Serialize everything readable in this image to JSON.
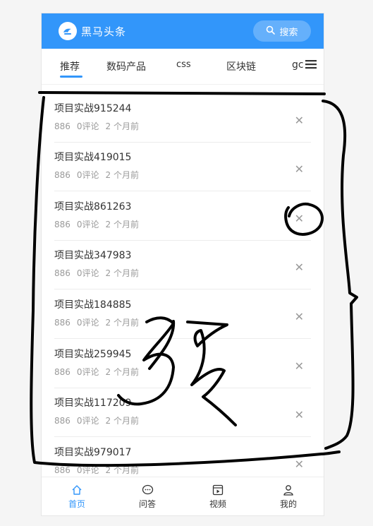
{
  "header": {
    "brand": "黑马头条",
    "search_label": "搜索"
  },
  "tabs": [
    {
      "label": "推荐"
    },
    {
      "label": "数码产品"
    },
    {
      "label": "css"
    },
    {
      "label": "区块链"
    },
    {
      "label": "gc"
    }
  ],
  "articles": [
    {
      "title": "项目实战915244",
      "views": "886",
      "comments": "0评论",
      "time": "2 个月前"
    },
    {
      "title": "项目实战419015",
      "views": "886",
      "comments": "0评论",
      "time": "2 个月前"
    },
    {
      "title": "项目实战861263",
      "views": "886",
      "comments": "0评论",
      "time": "2 个月前"
    },
    {
      "title": "项目实战347983",
      "views": "886",
      "comments": "0评论",
      "time": "2 个月前"
    },
    {
      "title": "项目实战184885",
      "views": "886",
      "comments": "0评论",
      "time": "2 个月前"
    },
    {
      "title": "项目实战259945",
      "views": "886",
      "comments": "0评论",
      "time": "2 个月前"
    },
    {
      "title": "项目实战117209",
      "views": "886",
      "comments": "0评论",
      "time": "2 个月前"
    },
    {
      "title": "项目实战979017",
      "views": "886",
      "comments": "0评论",
      "time": "2 个月前"
    }
  ],
  "bottom_nav": [
    {
      "label": "首页",
      "icon": "home-icon"
    },
    {
      "label": "问答",
      "icon": "chat-icon"
    },
    {
      "label": "视频",
      "icon": "video-icon"
    },
    {
      "label": "我的",
      "icon": "user-icon"
    }
  ],
  "annotation": {
    "handwritten_text": "3页"
  },
  "colors": {
    "accent": "#3296fa",
    "text": "#333333",
    "muted": "#9a9a9a"
  }
}
